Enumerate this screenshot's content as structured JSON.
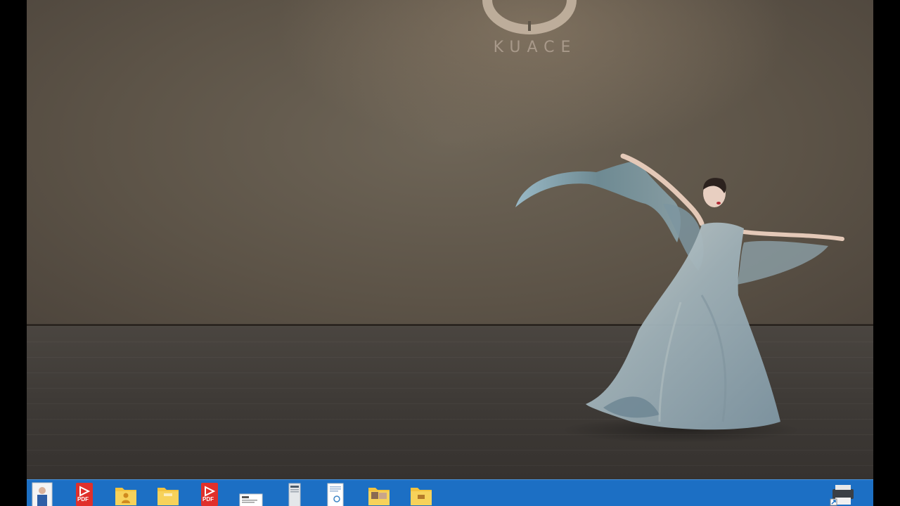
{
  "video": {
    "logo_text": "KUACE"
  },
  "taskbar": {
    "items": [
      {
        "icon": "person-photo-icon"
      },
      {
        "icon": "pdf-file-icon",
        "badge": "PDF"
      },
      {
        "icon": "user-folder-icon"
      },
      {
        "icon": "folder-icon"
      },
      {
        "icon": "pdf-file-icon",
        "badge": "PDF"
      },
      {
        "icon": "document-thumbnail-icon"
      },
      {
        "icon": "tall-document-icon"
      },
      {
        "icon": "text-document-icon"
      },
      {
        "icon": "photo-folder-icon"
      },
      {
        "icon": "folder-icon"
      },
      {
        "icon": "printer-shortcut-icon"
      }
    ]
  },
  "colors": {
    "taskbar": "#1c6fc4",
    "backdrop": "#5e5549",
    "floor": "#3f3b37",
    "pdf_red": "#e0302b",
    "folder_yellow": "#f3c33f"
  }
}
